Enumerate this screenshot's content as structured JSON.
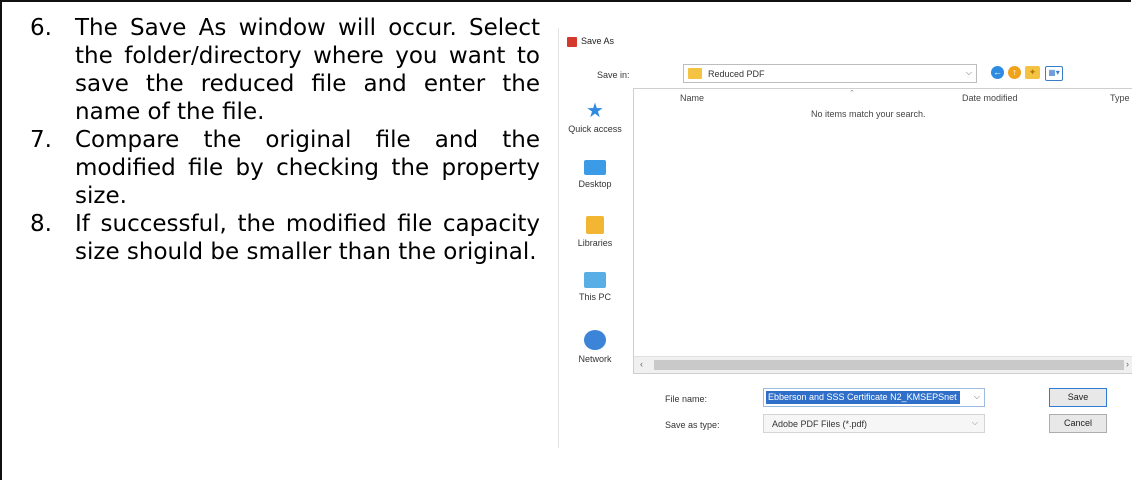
{
  "steps": [
    {
      "number": "6.",
      "text": "The Save As window will occur. Select the folder/directory where you want to save the reduced file and enter the name of the file."
    },
    {
      "number": "7.",
      "text": "Compare the original file and the modified file by checking the property size."
    },
    {
      "number": "8.",
      "text": "If successful, the modified file capacity size should be smaller than the original."
    }
  ],
  "dialog": {
    "title": "Save As",
    "save_in_label": "Save in:",
    "save_in_value": "Reduced PDF",
    "places": [
      {
        "label": "Quick access",
        "icon": "quick-access-star-icon"
      },
      {
        "label": "Desktop",
        "icon": "desktop-icon"
      },
      {
        "label": "Libraries",
        "icon": "libraries-icon"
      },
      {
        "label": "This PC",
        "icon": "this-pc-icon"
      },
      {
        "label": "Network",
        "icon": "network-icon"
      }
    ],
    "columns": {
      "name": "Name",
      "date_modified": "Date modified",
      "type": "Type"
    },
    "empty_message": "No items match your search.",
    "file_name_label": "File name:",
    "file_name_value": "Ebberson and SSS Certificate N2_KMSEPSnet",
    "save_as_type_label": "Save as type:",
    "save_as_type_value": "Adobe PDF Files (*.pdf)",
    "save_button": "Save",
    "cancel_button": "Cancel",
    "colors": {
      "selection": "#2f6fc9",
      "folder": "#f5c342",
      "pdf_icon": "#d33a2c"
    }
  }
}
